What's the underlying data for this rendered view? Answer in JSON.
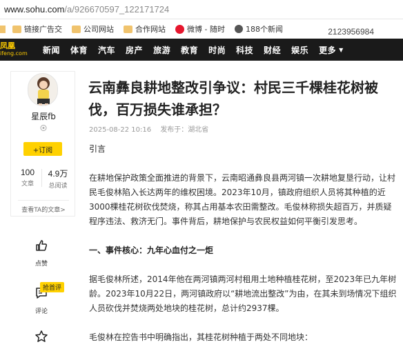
{
  "browser": {
    "url_host": "www.sohu.com",
    "url_path": "/a/926670597_122171724",
    "bookmarks": [
      "链接广告交",
      "公司网站",
      "合作网站",
      "微博 - 随时",
      "188个新闻"
    ],
    "extra_text": "2123956984"
  },
  "nav": {
    "logo_text": "凤凰",
    "logo_sub": "ifeng.com",
    "items": [
      "新闻",
      "体育",
      "汽车",
      "房产",
      "旅游",
      "教育",
      "时尚",
      "科技",
      "财经",
      "娱乐"
    ],
    "more": "更多"
  },
  "author": {
    "name": "星辰fb",
    "follow": "+订阅",
    "stats": [
      {
        "value": "100",
        "label": "文章"
      },
      {
        "value": "4.9万",
        "label": "总阅读"
      }
    ],
    "see_articles": "查看TA的文章>"
  },
  "actions": {
    "like": "点赞",
    "comment": "评论",
    "hot_badge": "抢首评"
  },
  "article": {
    "title": "云南彝良耕地整改引争议：村民三千棵桂花树被伐，百万损失谁承担？",
    "date": "2025-08-22 10:16",
    "published_in": "发布于：湖北省",
    "intro_heading": "引言",
    "p1": "在耕地保护政策全面推进的背景下，云南昭通彝良县两河镇一次耕地复垦行动，让村民毛俊林陷入长达两年的维权困境。2023年10月，镇政府组织人员将其种植的近3000棵桂花树砍伐焚烧，称其占用基本农田需整改。毛俊林称损失超百万，并质疑程序违法、救济无门。事件背后，耕地保护与农民权益如何平衡引发思考。",
    "h2": "一、事件核心：九年心血付之一炬",
    "p2": "据毛俊林所述，2014年他在两河镇两河村租用土地种植桂花树，至2023年已九年树龄。2023年10月22日，两河镇政府以“耕地流出整改”为由，在其未到场情况下组织人员砍伐并焚烧两处地块的桂花树，总计约2937棵。",
    "p3": "毛俊林在控告书中明确指出，其桂花树种植于两处不同地块："
  },
  "colors": {
    "nav_bg": "#1a1a1a",
    "accent": "#ffd100"
  }
}
